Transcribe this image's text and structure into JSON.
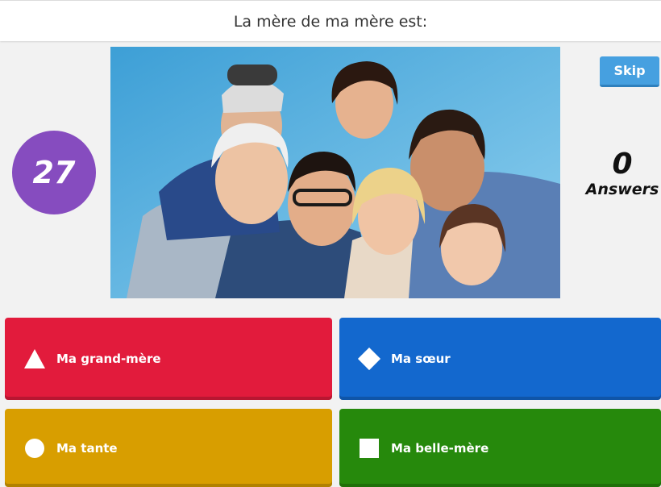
{
  "question": "La mère de ma mère est:",
  "timer": "27",
  "skip_label": "Skip",
  "answers": {
    "count": "0",
    "label": "Answers"
  },
  "choices": [
    {
      "label": "Ma grand-mère",
      "shape": "triangle-icon",
      "color": "#e21b3c"
    },
    {
      "label": "Ma sœur",
      "shape": "diamond-icon",
      "color": "#1368ce"
    },
    {
      "label": "Ma tante",
      "shape": "circle-icon",
      "color": "#d89e00"
    },
    {
      "label": "Ma belle-mère",
      "shape": "square-icon",
      "color": "#26890c"
    }
  ],
  "colors": {
    "timer": "#864cbf",
    "skip": "#46a0e0"
  }
}
